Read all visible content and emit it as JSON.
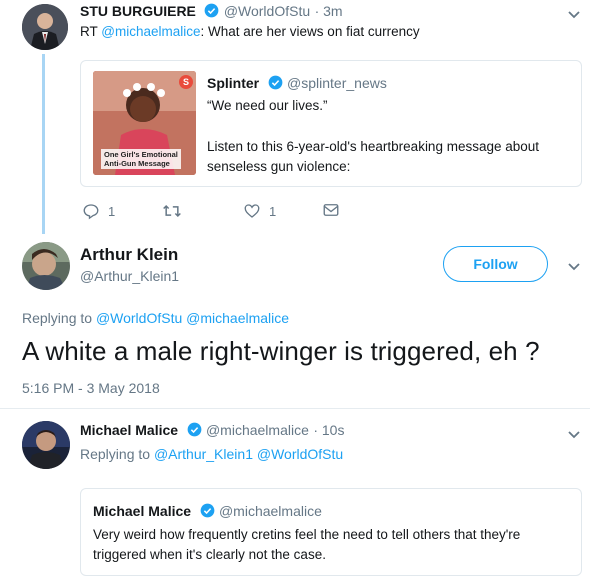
{
  "tweet1": {
    "name": "STU BURGUIERE",
    "handle": "@WorldOfStu",
    "time": "· 3m",
    "rt_prefix": "RT",
    "rt_mention": "@michaelmalice",
    "rt_text": ": What are her views on fiat currency",
    "card": {
      "name": "Splinter",
      "handle": "@splinter_news",
      "line1": "“We need our lives.”",
      "line2": "Listen to this 6-year-old's heartbreaking message about senseless gun violence:",
      "thumb_caption_1": "One Girl's Emotional",
      "thumb_caption_2": "Anti-Gun Message",
      "thumb_badge": "S"
    },
    "actions": {
      "replies": "1",
      "likes": "1"
    }
  },
  "tweet2": {
    "name": "Arthur Klein",
    "handle": "@Arthur_Klein1",
    "follow_label": "Follow",
    "replying_prefix": "Replying to",
    "replying_1": "@WorldOfStu",
    "replying_2": "@michaelmalice",
    "text": "A white a male right-winger is triggered, eh ?",
    "timestamp": "5:16 PM - 3 May 2018"
  },
  "tweet3": {
    "name": "Michael Malice",
    "handle": "@michaelmalice",
    "time": "· 10s",
    "replying_prefix": "Replying to",
    "replying_1": "@Arthur_Klein1",
    "replying_2": "@WorldOfStu",
    "quote": {
      "name": "Michael Malice",
      "handle": "@michaelmalice",
      "text": "Very weird how frequently cretins feel the need to tell others that they're triggered when it's clearly not the case."
    }
  },
  "colors": {
    "accent": "#1da1f2",
    "thread_line": "#a8d5f4",
    "muted": "#657786"
  }
}
